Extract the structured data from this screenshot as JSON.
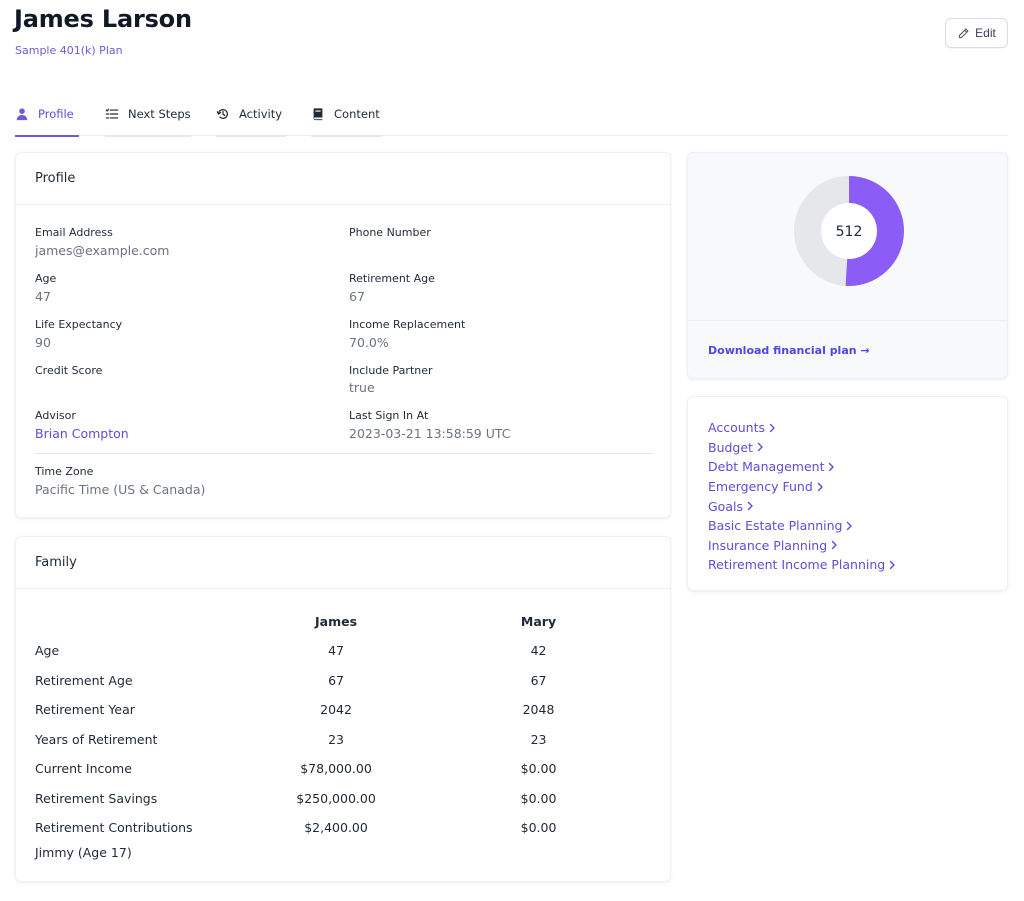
{
  "header": {
    "title": "James Larson",
    "subtitle": "Sample 401(k) Plan",
    "edit_label": "Edit"
  },
  "tabs": [
    {
      "label": "Profile",
      "icon": "user-icon",
      "active": true
    },
    {
      "label": "Next Steps",
      "icon": "list-icon",
      "active": false
    },
    {
      "label": "Activity",
      "icon": "history-icon",
      "active": false
    },
    {
      "label": "Content",
      "icon": "book-icon",
      "active": false
    }
  ],
  "profile": {
    "title": "Profile",
    "fields": {
      "email": {
        "label": "Email Address",
        "value": "james@example.com"
      },
      "phone": {
        "label": "Phone Number",
        "value": ""
      },
      "age": {
        "label": "Age",
        "value": "47"
      },
      "retirement_age": {
        "label": "Retirement Age",
        "value": "67"
      },
      "life_expectancy": {
        "label": "Life Expectancy",
        "value": "90"
      },
      "income_replacement": {
        "label": "Income Replacement",
        "value": "70.0%"
      },
      "credit_score": {
        "label": "Credit Score",
        "value": ""
      },
      "include_partner": {
        "label": "Include Partner",
        "value": "true"
      },
      "advisor": {
        "label": "Advisor",
        "value": "Brian Compton"
      },
      "last_sign_in": {
        "label": "Last Sign In At",
        "value": "2023-03-21 13:58:59 UTC"
      },
      "time_zone": {
        "label": "Time Zone",
        "value": "Pacific Time (US & Canada)"
      }
    }
  },
  "family": {
    "title": "Family",
    "columns": [
      "",
      "James",
      "Mary"
    ],
    "rows": [
      [
        "Age",
        "47",
        "42"
      ],
      [
        "Retirement Age",
        "67",
        "67"
      ],
      [
        "Retirement Year",
        "2042",
        "2048"
      ],
      [
        "Years of Retirement",
        "23",
        "23"
      ],
      [
        "Current Income",
        "$78,000.00",
        "$0.00"
      ],
      [
        "Retirement Savings",
        "$250,000.00",
        "$0.00"
      ],
      [
        "Retirement Contributions",
        "$2,400.00",
        "$0.00"
      ]
    ],
    "dependent": "Jimmy (Age 17)"
  },
  "score_card": {
    "score": "512",
    "fill_fraction": 0.51,
    "fill_color": "#8b5cf6",
    "track_color": "#e5e7eb",
    "download_label": "Download financial plan →"
  },
  "links": [
    "Accounts",
    "Budget",
    "Debt Management",
    "Emergency Fund",
    "Goals",
    "Basic Estate Planning",
    "Insurance Planning",
    "Retirement Income Planning"
  ],
  "colors": {
    "accent": "#6d5cd6",
    "link": "#5b4fd6"
  }
}
